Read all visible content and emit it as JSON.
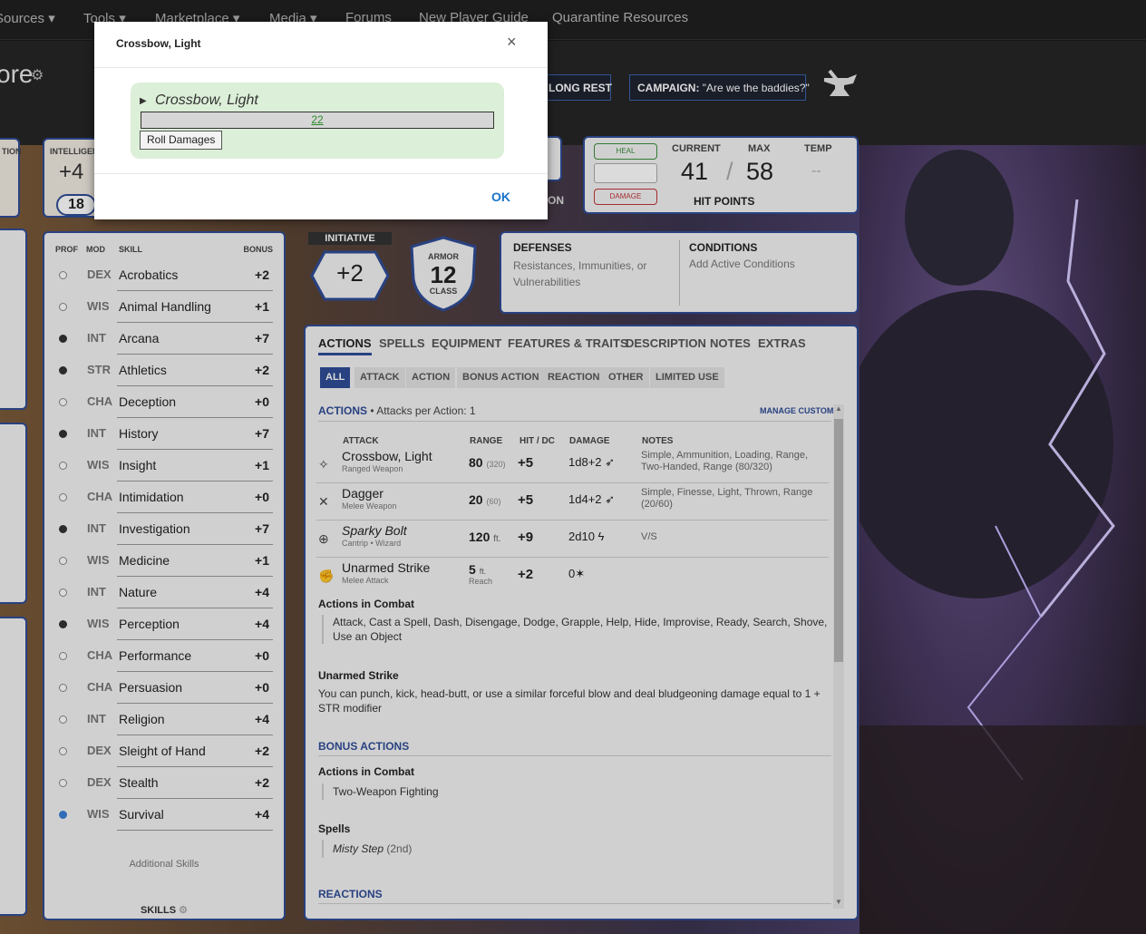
{
  "nav": {
    "items": [
      "Sources",
      "Tools",
      "Marketplace",
      "Media",
      "Forums",
      "New Player Guide",
      "Quarantine Resources"
    ]
  },
  "header": {
    "name_fragment": "ore",
    "long_rest": "LONG REST",
    "campaign_label": "CAMPAIGN:",
    "campaign_name": "\"Are we the baddies?\""
  },
  "abilities": {
    "left_label": "TION",
    "int_label": "INTELLIGEN",
    "int_mod": "+4",
    "int_score": "18"
  },
  "hp": {
    "heal": "HEAL",
    "damage": "DAMAGE",
    "current_label": "CURRENT",
    "max_label": "MAX",
    "temp_label": "TEMP",
    "current": "41",
    "separator": "/",
    "max": "58",
    "temp": "--",
    "title": "HIT POINTS",
    "side_label": "ON"
  },
  "skills": {
    "headers": {
      "prof": "PROF",
      "mod": "MOD",
      "skill": "SKILL",
      "bonus": "BONUS"
    },
    "rows": [
      {
        "prof": "none",
        "mod": "DEX",
        "name": "Acrobatics",
        "bonus": "+2"
      },
      {
        "prof": "none",
        "mod": "WIS",
        "name": "Animal Handling",
        "bonus": "+1"
      },
      {
        "prof": "prof",
        "mod": "INT",
        "name": "Arcana",
        "bonus": "+7"
      },
      {
        "prof": "prof",
        "mod": "STR",
        "name": "Athletics",
        "bonus": "+2"
      },
      {
        "prof": "none",
        "mod": "CHA",
        "name": "Deception",
        "bonus": "+0"
      },
      {
        "prof": "prof",
        "mod": "INT",
        "name": "History",
        "bonus": "+7"
      },
      {
        "prof": "none",
        "mod": "WIS",
        "name": "Insight",
        "bonus": "+1"
      },
      {
        "prof": "none",
        "mod": "CHA",
        "name": "Intimidation",
        "bonus": "+0"
      },
      {
        "prof": "prof",
        "mod": "INT",
        "name": "Investigation",
        "bonus": "+7"
      },
      {
        "prof": "none",
        "mod": "WIS",
        "name": "Medicine",
        "bonus": "+1"
      },
      {
        "prof": "none",
        "mod": "INT",
        "name": "Nature",
        "bonus": "+4"
      },
      {
        "prof": "prof",
        "mod": "WIS",
        "name": "Perception",
        "bonus": "+4"
      },
      {
        "prof": "none",
        "mod": "CHA",
        "name": "Performance",
        "bonus": "+0"
      },
      {
        "prof": "none",
        "mod": "CHA",
        "name": "Persuasion",
        "bonus": "+0"
      },
      {
        "prof": "none",
        "mod": "INT",
        "name": "Religion",
        "bonus": "+4"
      },
      {
        "prof": "none",
        "mod": "DEX",
        "name": "Sleight of Hand",
        "bonus": "+2"
      },
      {
        "prof": "none",
        "mod": "DEX",
        "name": "Stealth",
        "bonus": "+2"
      },
      {
        "prof": "exp",
        "mod": "WIS",
        "name": "Survival",
        "bonus": "+4"
      }
    ],
    "additional": "Additional Skills",
    "footer": "SKILLS"
  },
  "combat": {
    "initiative_label": "INITIATIVE",
    "initiative": "+2",
    "armor_top": "ARMOR",
    "armor": "12",
    "armor_bottom": "CLASS"
  },
  "defenses": {
    "title": "DEFENSES",
    "text": "Resistances, Immunities, or Vulnerabilities",
    "conditions_title": "CONDITIONS",
    "conditions_text": "Add Active Conditions"
  },
  "tabs": [
    "ACTIONS",
    "SPELLS",
    "EQUIPMENT",
    "FEATURES & TRAITS",
    "DESCRIPTION",
    "NOTES",
    "EXTRAS"
  ],
  "subtabs": [
    "ALL",
    "ATTACK",
    "ACTION",
    "BONUS ACTION",
    "REACTION",
    "OTHER",
    "LIMITED USE"
  ],
  "actions": {
    "title": "ACTIONS",
    "attacks_per": "• Attacks per Action: 1",
    "manage": "MANAGE CUSTOM",
    "headers": {
      "attack": "ATTACK",
      "range": "RANGE",
      "hit": "HIT / DC",
      "damage": "DAMAGE",
      "notes": "NOTES"
    },
    "rows": [
      {
        "name": "Crossbow, Light",
        "sub": "Ranged Weapon",
        "range": "80",
        "range_long": "(320)",
        "hit": "+5",
        "damage": "1d8+2",
        "notes": "Simple, Ammunition, Loading, Range, Two-Handed, Range (80/320)"
      },
      {
        "name": "Dagger",
        "sub": "Melee Weapon",
        "range": "20",
        "range_long": "(60)",
        "hit": "+5",
        "damage": "1d4+2",
        "notes": "Simple, Finesse, Light, Thrown, Range (20/60)"
      },
      {
        "name": "Sparky Bolt",
        "sub": "Cantrip • Wizard",
        "range": "120",
        "range_long": "ft.",
        "hit": "+9",
        "damage": "2d10",
        "notes": "V/S"
      },
      {
        "name": "Unarmed Strike",
        "sub": "Melee Attack",
        "range": "5",
        "range_long": "ft.",
        "range_sub": "Reach",
        "hit": "+2",
        "damage": "0",
        "notes": ""
      }
    ],
    "combat_title": "Actions in Combat",
    "combat_text": "Attack, Cast a Spell, Dash, Disengage, Dodge, Grapple, Help, Hide, Improvise, Ready, Search, Shove, Use an Object",
    "unarmed_title": "Unarmed Strike",
    "unarmed_text": "You can punch, kick, head-butt, or use a similar forceful blow and deal bludgeoning damage equal to 1 + STR modifier",
    "bonus_title": "BONUS ACTIONS",
    "bonus_combat_title": "Actions in Combat",
    "bonus_combat_text": "Two-Weapon Fighting",
    "spells_title": "Spells",
    "spell_name": "Misty Step",
    "spell_level": "(2nd)",
    "reactions_title": "REACTIONS"
  },
  "dialog": {
    "title": "Crossbow, Light",
    "close": "×",
    "roll_title": "Crossbow, Light",
    "roll_result": "22",
    "roll_button": "Roll Damages",
    "ok": "OK"
  },
  "colors": {
    "accent": "#2f4c96",
    "roll_bg": "#dcefd8",
    "link_green": "#2a8a2a",
    "ok_blue": "#1a73c9"
  }
}
